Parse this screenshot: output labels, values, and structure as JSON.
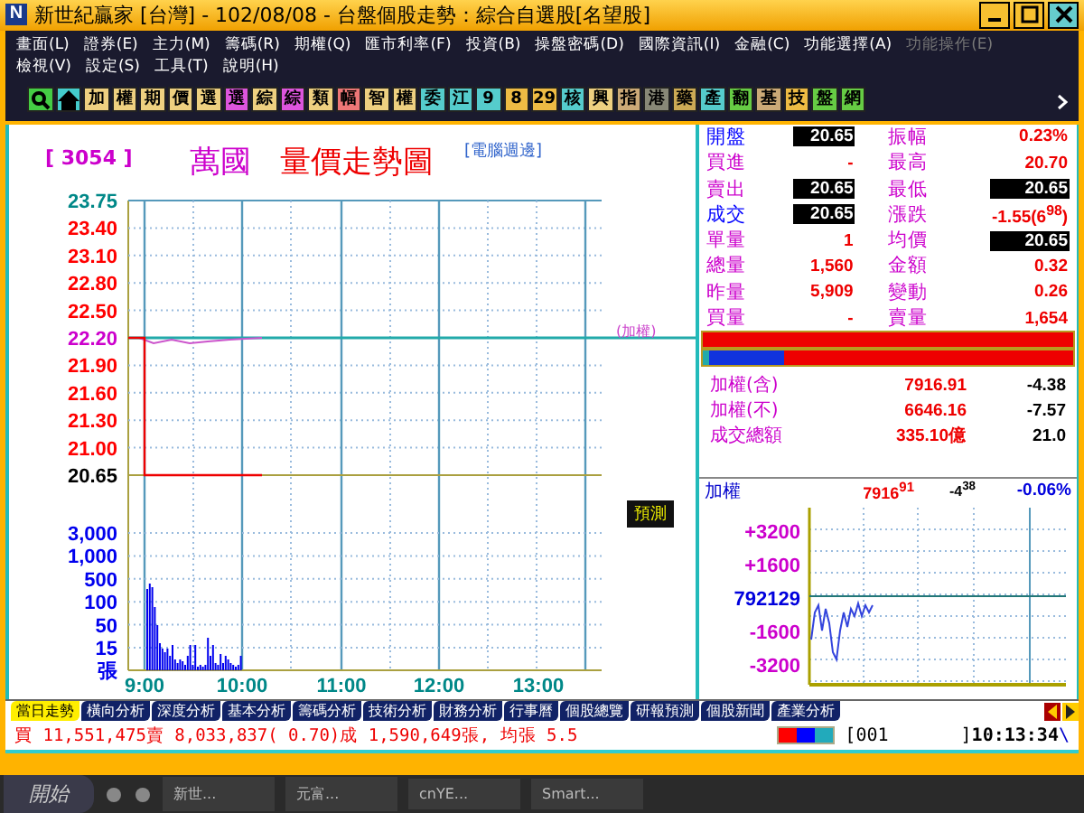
{
  "window": {
    "logo": "N",
    "title": "新世紀贏家 [台灣]  - 102/08/08 - 台盤個股走勢：綜合自選股[名望股]"
  },
  "menu_rows": [
    [
      {
        "label": "畫面(L)",
        "disabled": false
      },
      {
        "label": "證券(E)",
        "disabled": false
      },
      {
        "label": "主力(M)",
        "disabled": false
      },
      {
        "label": "籌碼(R)",
        "disabled": false
      },
      {
        "label": "期權(Q)",
        "disabled": false
      },
      {
        "label": "匯市利率(F)",
        "disabled": false
      },
      {
        "label": "投資(B)",
        "disabled": false
      },
      {
        "label": "操盤密碼(D)",
        "disabled": false
      },
      {
        "label": "國際資訊(I)",
        "disabled": false
      },
      {
        "label": "金融(C)",
        "disabled": false
      },
      {
        "label": "功能選擇(A)",
        "disabled": false
      },
      {
        "label": "功能操作(E)",
        "disabled": true
      }
    ],
    [
      {
        "label": "檢視(V)",
        "disabled": false
      },
      {
        "label": "設定(S)",
        "disabled": false
      },
      {
        "label": "工具(T)",
        "disabled": false
      },
      {
        "label": "說明(H)",
        "disabled": false
      }
    ]
  ],
  "toolbar": [
    {
      "kind": "search",
      "color": "#44cc44"
    },
    {
      "kind": "home",
      "color": "#44cccc"
    },
    {
      "kind": "text",
      "label": "加",
      "color": "#eed080"
    },
    {
      "kind": "text",
      "label": "權",
      "color": "#eed080"
    },
    {
      "kind": "text",
      "label": "期",
      "color": "#eed080"
    },
    {
      "kind": "text",
      "label": "價",
      "color": "#eed080"
    },
    {
      "kind": "text",
      "label": "選",
      "color": "#eed080"
    },
    {
      "kind": "text",
      "label": "選",
      "color": "#dd55dd"
    },
    {
      "kind": "text",
      "label": "綜",
      "color": "#eed080"
    },
    {
      "kind": "text",
      "label": "綜",
      "color": "#dd55dd"
    },
    {
      "kind": "text",
      "label": "類",
      "color": "#eed080"
    },
    {
      "kind": "text",
      "label": "幅",
      "color": "#ee7777"
    },
    {
      "kind": "text",
      "label": "智",
      "color": "#eed080"
    },
    {
      "kind": "text",
      "label": "權",
      "color": "#eed080"
    },
    {
      "kind": "text",
      "label": "委",
      "color": "#55cccc"
    },
    {
      "kind": "text",
      "label": "江",
      "color": "#55cccc"
    },
    {
      "kind": "text",
      "label": "9",
      "color": "#55cccc"
    },
    {
      "kind": "text",
      "label": "8",
      "color": "#eebb44"
    },
    {
      "kind": "text",
      "label": "29",
      "color": "#eebb44"
    },
    {
      "kind": "text",
      "label": "核",
      "color": "#55cccc"
    },
    {
      "kind": "text",
      "label": "興",
      "color": "#eed080"
    },
    {
      "kind": "text",
      "label": "指",
      "color": "#ccaa77"
    },
    {
      "kind": "text",
      "label": "港",
      "color": "#888877"
    },
    {
      "kind": "text",
      "label": "藥",
      "color": "#ccaa55"
    },
    {
      "kind": "text",
      "label": "產",
      "color": "#55cccc"
    },
    {
      "kind": "text",
      "label": "翻",
      "color": "#66cc44"
    },
    {
      "kind": "text",
      "label": "基",
      "color": "#ccaa77"
    },
    {
      "kind": "text",
      "label": "技",
      "color": "#eebb44"
    },
    {
      "kind": "text",
      "label": "盤",
      "color": "#66cc44"
    },
    {
      "kind": "text",
      "label": "網",
      "color": "#66cc44"
    }
  ],
  "chart": {
    "code": "[ 3054 ]",
    "name": "萬國",
    "title": "量價走勢圖",
    "category": "[電腦週邊]",
    "index_tag": "(加權)",
    "forecast": "預測",
    "price_ticks": [
      {
        "label": "23.75",
        "color": "#008888"
      },
      {
        "label": "23.40",
        "color": "#ff0000"
      },
      {
        "label": "23.10",
        "color": "#ff0000"
      },
      {
        "label": "22.80",
        "color": "#ff0000"
      },
      {
        "label": "22.50",
        "color": "#ff0000"
      },
      {
        "label": "22.20",
        "color": "#cc00cc"
      },
      {
        "label": "21.90",
        "color": "#ff0000"
      },
      {
        "label": "21.60",
        "color": "#ff0000"
      },
      {
        "label": "21.30",
        "color": "#ff0000"
      },
      {
        "label": "21.00",
        "color": "#ff0000"
      },
      {
        "label": "20.65",
        "color": "#000000"
      }
    ],
    "volume_ticks": [
      "3,000",
      "1,000",
      "500",
      "100",
      "50",
      "15",
      "張"
    ],
    "time_ticks": [
      "9:00",
      "10:00",
      "11:00",
      "12:00",
      "13:00"
    ]
  },
  "quote": [
    {
      "label": "開盤",
      "color": "#0000ff",
      "value": "20.65",
      "boxed": true,
      "label2": "振幅",
      "value2": "0.23%",
      "boxed2": false
    },
    {
      "label": "買進",
      "color": "#cc00cc",
      "value": "-",
      "boxed": false,
      "label2": "最高",
      "value2": "20.70",
      "boxed2": false
    },
    {
      "label": "賣出",
      "color": "#cc00cc",
      "value": "20.65",
      "boxed": true,
      "label2": "最低",
      "value2": "20.65",
      "boxed2": true
    },
    {
      "label": "成交",
      "color": "#0000ff",
      "value": "20.65",
      "boxed": true,
      "label2": "漲跌",
      "value2": "-1.55(6$^{98}$)",
      "boxed2": false
    },
    {
      "label": "單量",
      "color": "#cc00cc",
      "value": "1",
      "boxed": false,
      "label2": "均價",
      "value2": "20.65",
      "boxed2": true
    },
    {
      "label": "總量",
      "color": "#cc00cc",
      "value": "1,560",
      "boxed": false,
      "label2": "金額",
      "value2": "0.32",
      "boxed2": false
    },
    {
      "label": "昨量",
      "color": "#cc00cc",
      "value": "5,909",
      "boxed": false,
      "label2": "變動",
      "value2": "0.26",
      "boxed2": false
    },
    {
      "label": "買量",
      "color": "#cc00cc",
      "value": "-",
      "boxed": false,
      "label2": "賣量",
      "value2": "1,654",
      "boxed2": false
    }
  ],
  "ratio_bars": [
    {
      "level": 0.22
    }
  ],
  "index_stats": [
    {
      "name": "加權(含)",
      "value": "7916.91",
      "change": "-4.38"
    },
    {
      "name": "加權(不)",
      "value": "6646.16",
      "change": "-7.57"
    },
    {
      "name": "成交總額",
      "value": "335.10億",
      "change": "21.0"
    }
  ],
  "index_chart": {
    "name": "加權",
    "value": "7916$^{91}$",
    "change": "-4$^{38}$",
    "percent": "-0.06%",
    "ticks": [
      "+3200",
      "+1600",
      "792129",
      "-1600",
      "-3200"
    ]
  },
  "tabs": [
    {
      "label": "當日走勢",
      "selected": true
    },
    {
      "label": "橫向分析",
      "selected": false
    },
    {
      "label": "深度分析",
      "selected": false
    },
    {
      "label": "基本分析",
      "selected": false
    },
    {
      "label": "籌碼分析",
      "selected": false
    },
    {
      "label": "技術分析",
      "selected": false
    },
    {
      "label": "財務分析",
      "selected": false
    },
    {
      "label": "行事曆",
      "selected": false
    },
    {
      "label": "個股總覽",
      "selected": false
    },
    {
      "label": "研報預測",
      "selected": false
    },
    {
      "label": "個股新聞",
      "selected": false
    },
    {
      "label": "產業分析",
      "selected": false
    }
  ],
  "status_bar": {
    "summary": "買 11,551,475賣 8,033,837( 0.70)成 1,590,649張, 均張 5.5",
    "page_open": "[001",
    "page_close": "]",
    "time": "10:13:34",
    "mark": "\\"
  },
  "taskbar": {
    "start": "開始",
    "items": [
      "新世...",
      "元富...",
      "cnYE...",
      "Smart..."
    ]
  }
}
